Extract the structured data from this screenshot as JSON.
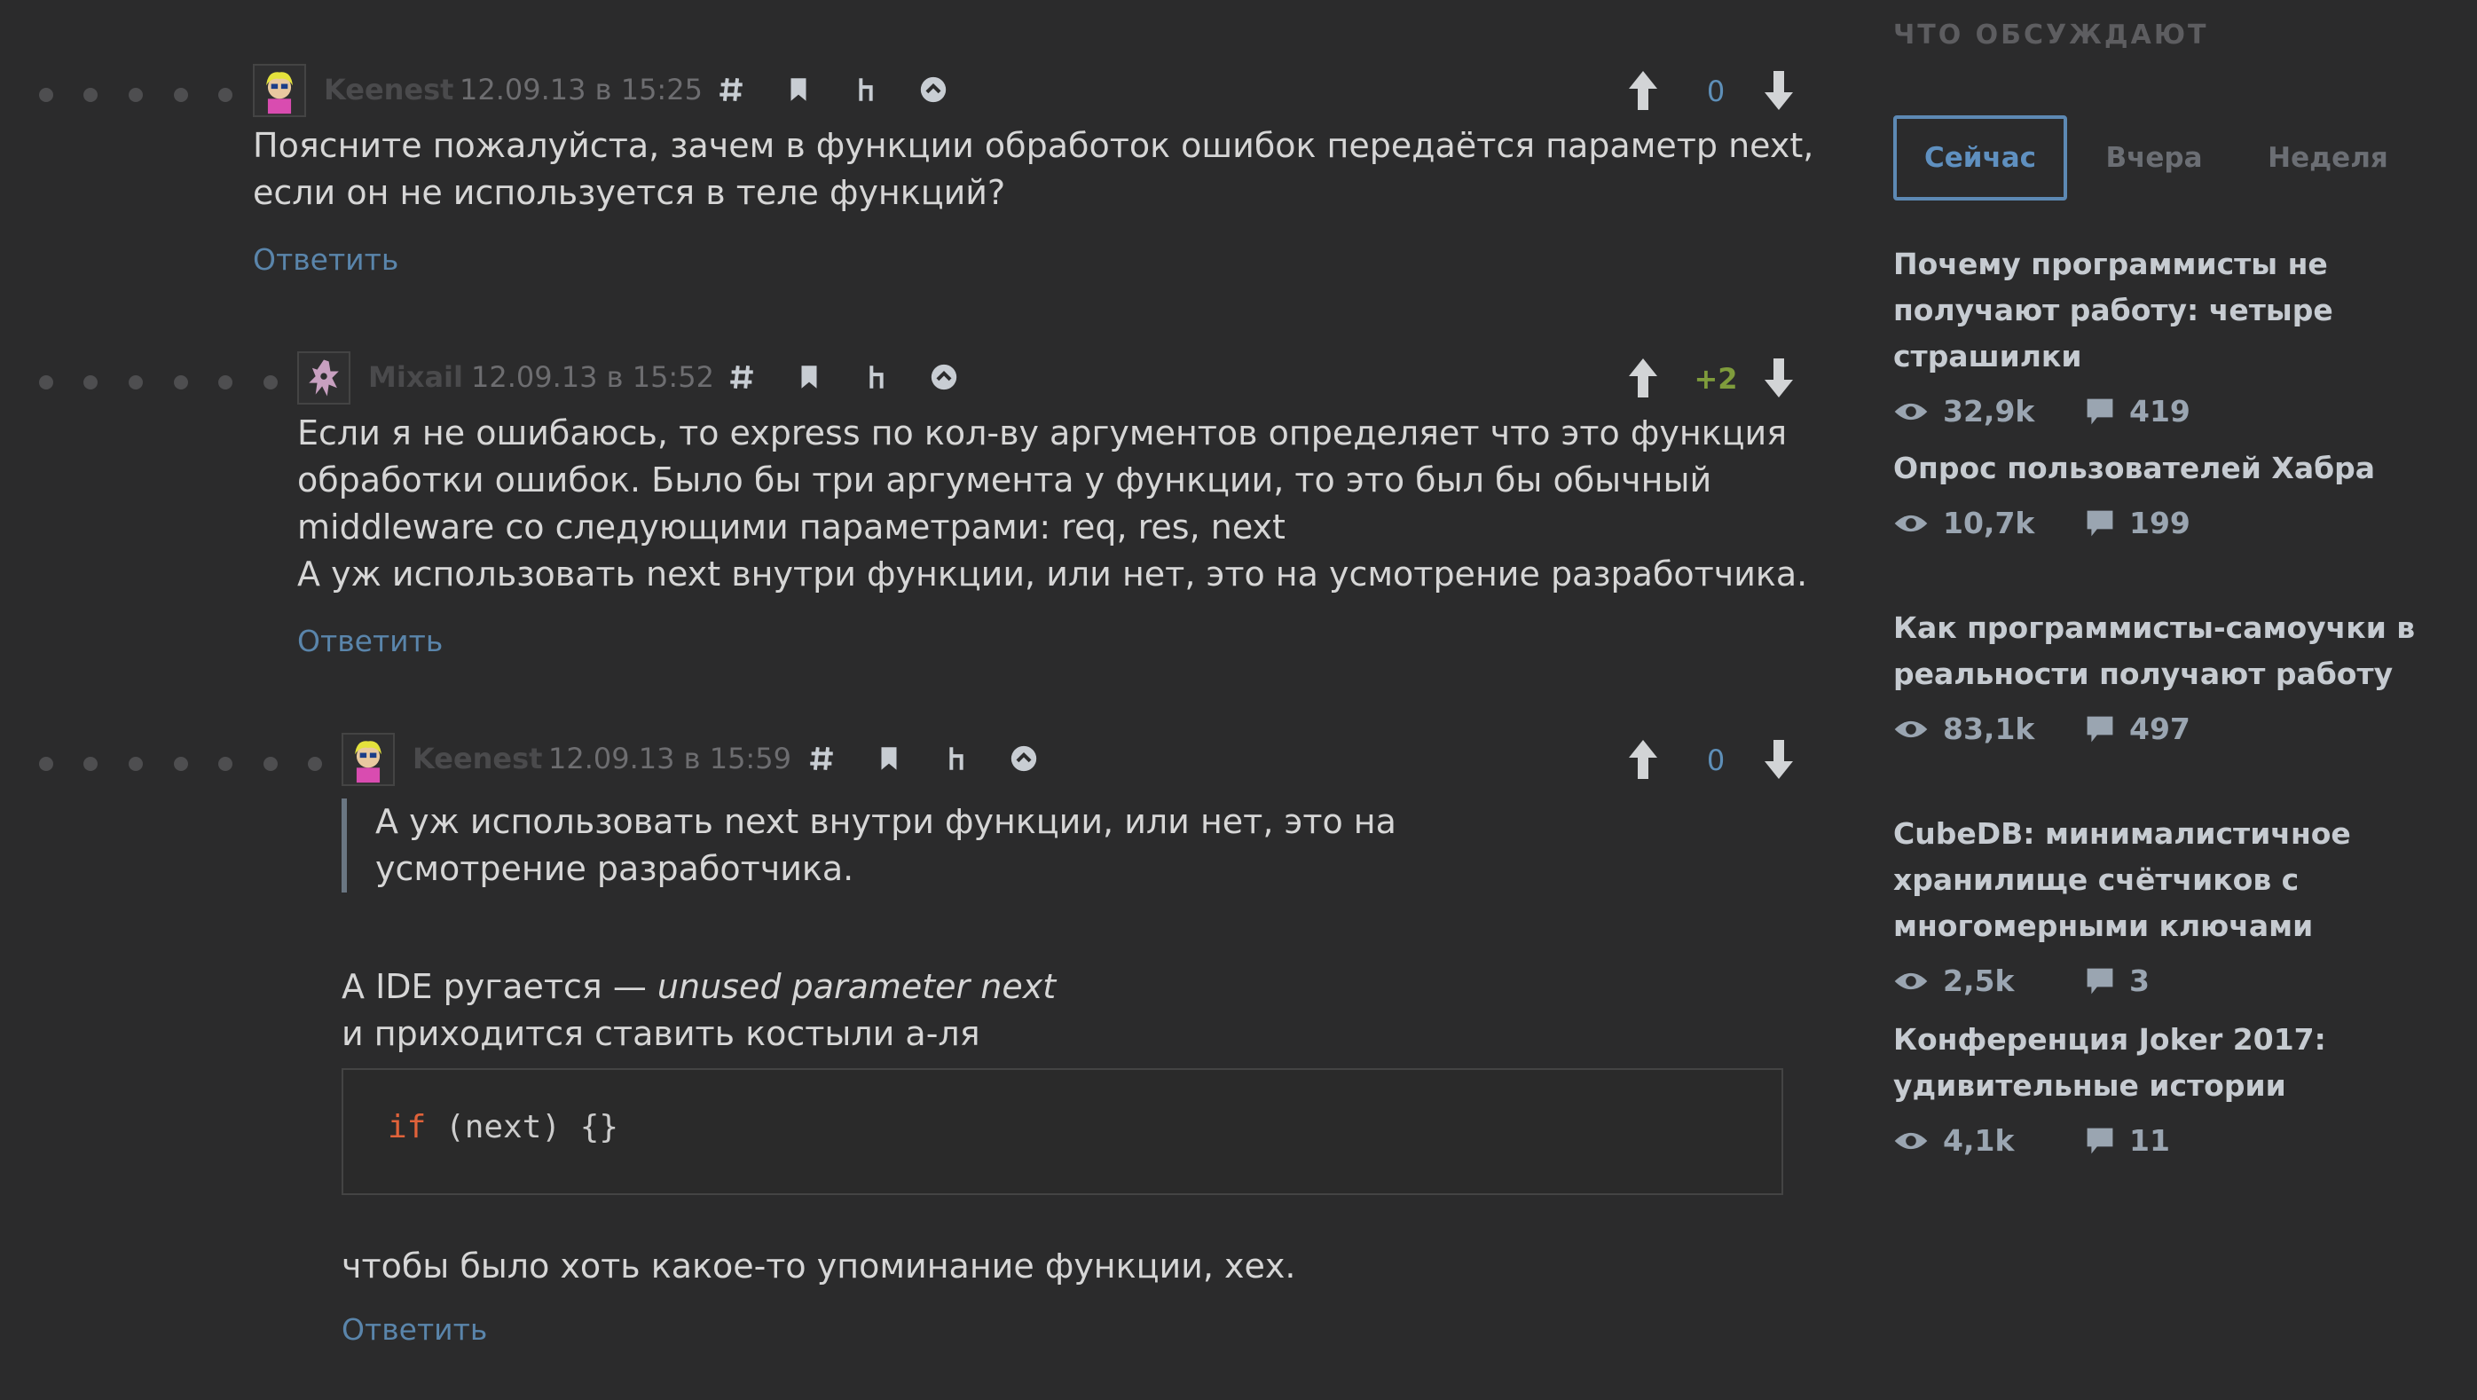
{
  "comments": [
    {
      "user": "Keenest",
      "date": "12.09.13 в 15:25",
      "score": "0",
      "text": "Поясните пожалуйста, зачем в функции обработок ошибок передаётся параметр next, если он не используется в теле функций?",
      "reply": "Ответить"
    },
    {
      "user": "Mixail",
      "date": "12.09.13 в 15:52",
      "score": "+2",
      "lines": [
        "Если я не ошибаюсь, то express по кол-ву аргументов определяет что это функция",
        "обработки ошибок. Было бы три аргумента у функции, то это был бы обычный",
        "middleware со следующими параметрами: req, res, next",
        "А уж использовать next внутри функции, или нет, это на усмотрение разработчика."
      ],
      "reply": "Ответить"
    },
    {
      "user": "Keenest",
      "date": "12.09.13 в 15:59",
      "score": "0",
      "quote": "А уж использовать next внутри функции, или нет, это на усмотрение разработчика.",
      "text_before": "A IDE ругается — ",
      "text_italic": "unused parameter next",
      "text_line2": "и приходится ставить костыли а-ля",
      "code_kw": "if",
      "code_rest": " (next) {}",
      "text_after": "чтобы было хоть какое-то упоминание функции, хех.",
      "reply": "Ответить"
    }
  ],
  "sidebar": {
    "title": "ЧТО ОБСУЖДАЮТ",
    "tabs": [
      "Сейчас",
      "Вчера",
      "Неделя"
    ],
    "posts": [
      {
        "title": "Почему программисты не получают работу: четыре страшилки",
        "views": "32,9k",
        "comments": "419"
      },
      {
        "title": "Опрос пользователей Хабра",
        "views": "10,7k",
        "comments": "199"
      },
      {
        "title": "Как программисты-самоучки в реальности получают работу",
        "views": "83,1k",
        "comments": "497"
      },
      {
        "title": "CubeDB: минималистичное хранилище счётчиков с многомерными ключами",
        "views": "2,5k",
        "comments": "3"
      },
      {
        "title": "Конференция Joker 2017: удивительные истории",
        "views": "4,1k",
        "comments": "11"
      }
    ]
  },
  "colors": {
    "background": "#2b2b2c",
    "link": "#5a85ab",
    "active_tab": "#5d89b4",
    "positive_score": "#7f9c3c",
    "keyword": "#e0623a"
  },
  "icons": [
    "hash-icon",
    "bookmark-icon",
    "parent-link-icon",
    "collapse-up-icon",
    "upvote-arrow-icon",
    "downvote-arrow-icon",
    "eye-icon",
    "comment-bubble-icon"
  ]
}
